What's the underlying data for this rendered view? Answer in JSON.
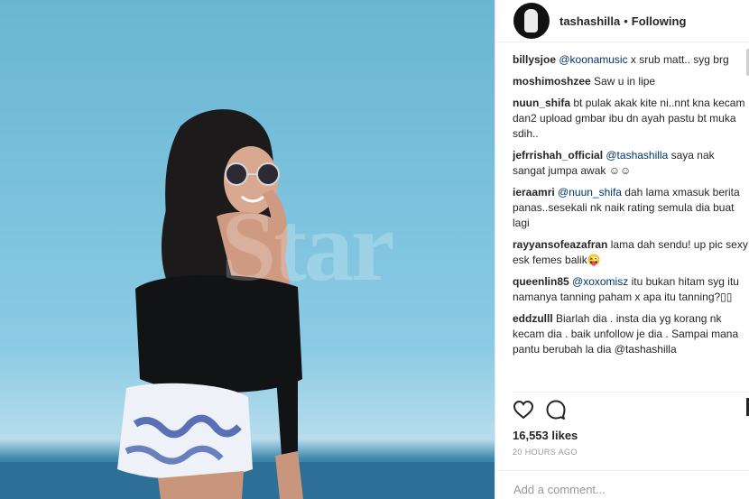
{
  "photo": {
    "watermark": "Star"
  },
  "header": {
    "username": "tashashilla",
    "separator": "•",
    "follow_label": "Following"
  },
  "comments": [
    {
      "user": "billysjoe",
      "mention": "@koonamusic",
      "text": " x srub matt.. syg brg"
    },
    {
      "user": "moshimoshzee",
      "mention": "",
      "text": "Saw u in lipe"
    },
    {
      "user": "nuun_shifa",
      "mention": "",
      "text": "bt pulak akak kite ni..nnt kna kecam dan2 upload gmbar ibu dn ayah pastu bt muka sdih.."
    },
    {
      "user": "jefrrishah_official",
      "mention": "@tashashilla",
      "text": " saya nak sangat jumpa awak ☺☺"
    },
    {
      "user": "ieraamri",
      "mention": "@nuun_shifa",
      "text": " dah lama xmasuk berita panas..sesekali nk naik rating semula dia buat lagi"
    },
    {
      "user": "rayyansofeazafran",
      "mention": "",
      "text": "lama dah sendu! up pic sexy esk femes balik😜"
    },
    {
      "user": "queenlin85",
      "mention": "@xoxomisz",
      "text": " itu bukan hitam syg itu namanya tanning paham x apa itu tanning?▯▯"
    },
    {
      "user": "eddzulll",
      "mention": "",
      "text": "Biarlah dia . insta dia yg korang nk kecam dia . baik unfollow je dia . Sampai mana pantu berubah la dia @tashashilla"
    }
  ],
  "actions": {
    "like_icon": "heart-outline-icon",
    "comment_icon": "comment-bubble-icon"
  },
  "likes": "16,553 likes",
  "time": "20 HOURS AGO",
  "add_comment_placeholder": "Add a comment..."
}
